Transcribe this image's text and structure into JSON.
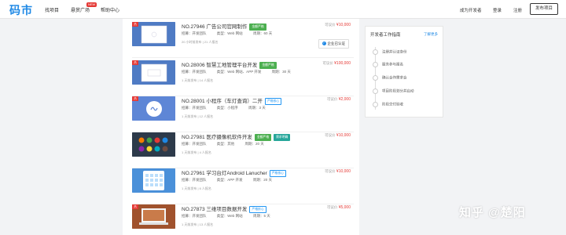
{
  "nav": {
    "logo": "码市",
    "items": [
      "找项目",
      "悬赏广场",
      "帮助中心"
    ],
    "new_badge": "NEW",
    "right": {
      "become_dev": "成为开发者",
      "login": "登录",
      "register": "注册",
      "publish": "发布项目"
    }
  },
  "projects": [
    {
      "no": "NO.27946 广告公司官网制作",
      "badges": [
        {
          "text": "金额严格",
          "style": "green"
        }
      ],
      "price_label": "可议价",
      "price": "¥10,000",
      "meta": [
        "招募：开发团队",
        "类型：Web 网站",
        "周期：60 天"
      ],
      "sub": "20 小时前发布 | 21 人报名",
      "verified": "企业已认证",
      "tag": "热",
      "thumb_bg": "#4f7bc4"
    },
    {
      "no": "NO.28006 智慧工地管理平台开发",
      "badges": [
        {
          "text": "金额严格",
          "style": "green"
        }
      ],
      "price_label": "可议价",
      "price": "¥100,000",
      "meta": [
        "招募：开发团队",
        "类型：Web 网站、APP 开发",
        "周期：30 天"
      ],
      "sub": "1 天前发布 | 14 人报名",
      "verified": "",
      "tag": "热",
      "thumb_bg": "#4f7bc4"
    },
    {
      "no": "NO.28001 小程序（车灯查询）二开",
      "badges": [
        {
          "text": "严格核心",
          "style": "blue"
        }
      ],
      "price_label": "可议价",
      "price": "¥2,000",
      "meta": [
        "招募：开发团队",
        "类型：小程序",
        "周期：3 天"
      ],
      "sub": "1 天前发布 | 12 人报名",
      "verified": "",
      "tag": "热",
      "thumb_bg": "#5e86d6"
    },
    {
      "no": "NO.27981 医疗摄像机软件开发",
      "badges": [
        {
          "text": "金额严格",
          "style": "green"
        },
        {
          "text": "需求明确",
          "style": "teal"
        }
      ],
      "price_label": "可议价",
      "price": "¥10,000",
      "meta": [
        "招募：开发团队",
        "类型：其他",
        "周期：20 天"
      ],
      "sub": "1 天前发布 | 4 人报名",
      "verified": "",
      "tag": "",
      "thumb_bg": "#2d3a4a"
    },
    {
      "no": "NO.27961 学习台灯Android Lanucher",
      "badges": [
        {
          "text": "严格核心",
          "style": "blue"
        }
      ],
      "price_label": "可议价",
      "price": "¥10,000",
      "meta": [
        "招募：开发团队",
        "类型：APP 开发",
        "周期：20 天"
      ],
      "sub": "1 天前发布 | 6 人报名",
      "verified": "",
      "tag": "",
      "thumb_bg": "#4a90d9"
    },
    {
      "no": "NO.27873 三维项目数据开发",
      "badges": [
        {
          "text": "严格核心",
          "style": "blue"
        }
      ],
      "price_label": "可议价",
      "price": "¥5,000",
      "meta": [
        "招募：开发团队",
        "类型：Web 网站",
        "周期：5 天"
      ],
      "sub": "1 天前发布 | 13 人报名",
      "verified": "",
      "tag": "热",
      "thumb_bg": "#a0522d"
    }
  ],
  "guide": {
    "title": "开发者工作指南",
    "more": "了解更多",
    "steps": [
      "注册并认证身份",
      "服务参与报名",
      "确认合作需求合",
      "项目阶段划分并启动",
      "阶段交付验收"
    ]
  },
  "watermark": "知乎 @楚阳"
}
